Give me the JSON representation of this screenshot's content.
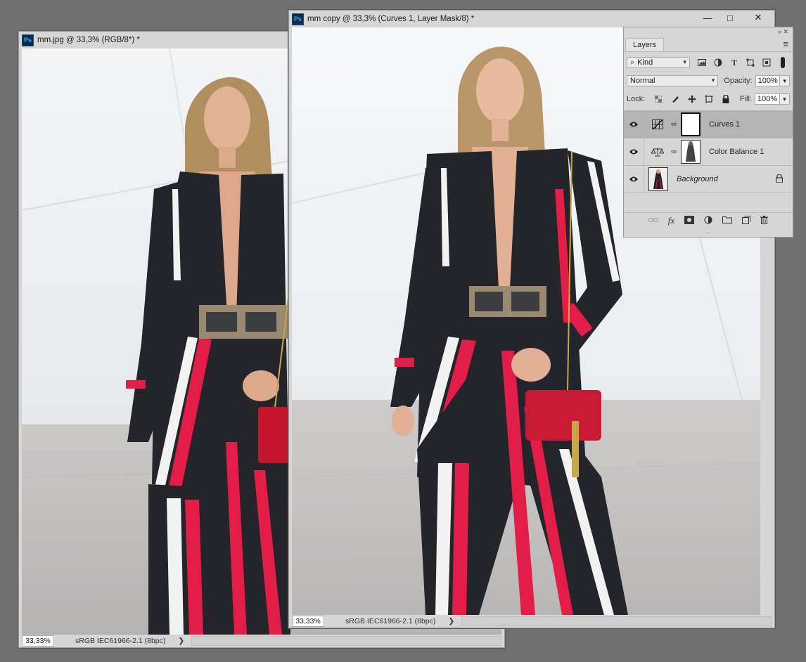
{
  "window_left": {
    "title": "mm.jpg @ 33,3% (RGB/8*) *",
    "zoom": "33,33%",
    "profile": "sRGB IEC61966-2.1 (8bpc)",
    "arrow": "❯"
  },
  "window_right": {
    "title": "mm copy @ 33,3% (Curves 1, Layer Mask/8) *",
    "zoom": "33,33%",
    "profile": "sRGB IEC61966-2.1 (8bpc)",
    "arrow": "❯",
    "buttons": {
      "minimize": "—",
      "maximize": "□",
      "close": "✕"
    }
  },
  "ps_icon_text": "Ps",
  "layers_panel": {
    "collapse_label": "« ✕",
    "tab": "Layers",
    "menu_icon": "≡",
    "filter": {
      "kind_label": "Kind",
      "search_glyph": "⌕"
    },
    "blend_mode": "Normal",
    "opacity_label": "Opacity:",
    "opacity_value": "100%",
    "lock_label": "Lock:",
    "fill_label": "Fill:",
    "fill_value": "100%",
    "layers": [
      {
        "name": "Curves 1",
        "selected": true,
        "type": "adjustment",
        "icon": "curves-icon"
      },
      {
        "name": "Color Balance 1",
        "selected": false,
        "type": "adjustment",
        "icon": "color-balance-icon"
      },
      {
        "name": "Background",
        "selected": false,
        "type": "pixel",
        "locked": true
      }
    ],
    "bottom_icons": [
      "link-icon",
      "fx-icon",
      "mask-icon",
      "adjustment-icon",
      "group-icon",
      "new-layer-icon",
      "trash-icon"
    ],
    "fx_label": "fx"
  },
  "colors": {
    "workspace": "#6f6f6f",
    "panel": "#d6d6d6",
    "selected_layer": "#b4b4b4",
    "stripe_red": "#e11d48",
    "jacket_black": "#23252a"
  }
}
